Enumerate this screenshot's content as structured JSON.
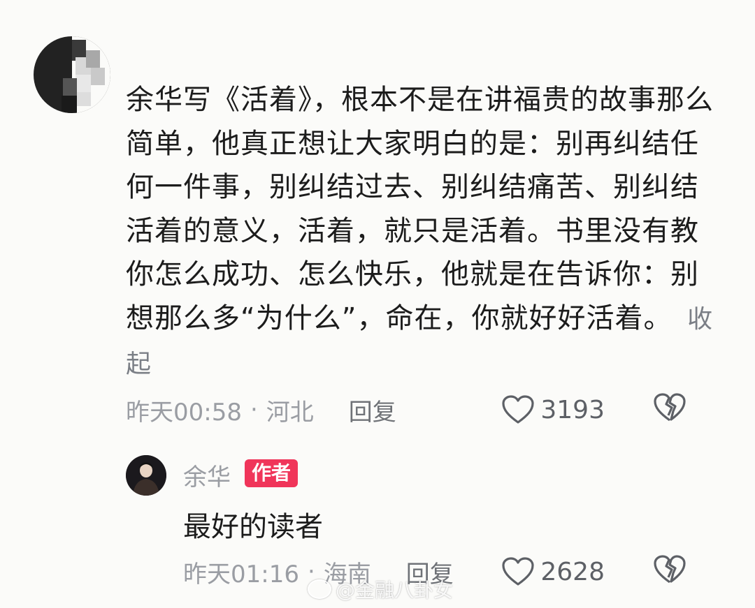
{
  "comment": {
    "text": "余华写《活着》，根本不是在讲福贵的故事那么简单，他真正想让大家明白的是：别再纠结任何一件事，别纠结过去、别纠结痛苦、别纠结活着的意义，活着，就只是活着。书里没有教你怎么成功、怎么快乐，他就是在告诉你：别想那么多“为什么”，命在，你就好好活着。",
    "collapse_label": "收起",
    "time": "昨天00:58",
    "separator": "·",
    "location": "河北",
    "reply_label": "回复",
    "likes": "3193"
  },
  "reply": {
    "author": "余华",
    "badge": "作者",
    "text": "最好的读者",
    "time": "昨天01:16",
    "separator": "·",
    "location": "海南",
    "reply_label": "回复",
    "likes": "2628"
  },
  "watermark": "@金融八卦女",
  "colors": {
    "badge": "#f0355a",
    "meta_text": "#9a9da3",
    "body_text": "#1c1c1c"
  }
}
